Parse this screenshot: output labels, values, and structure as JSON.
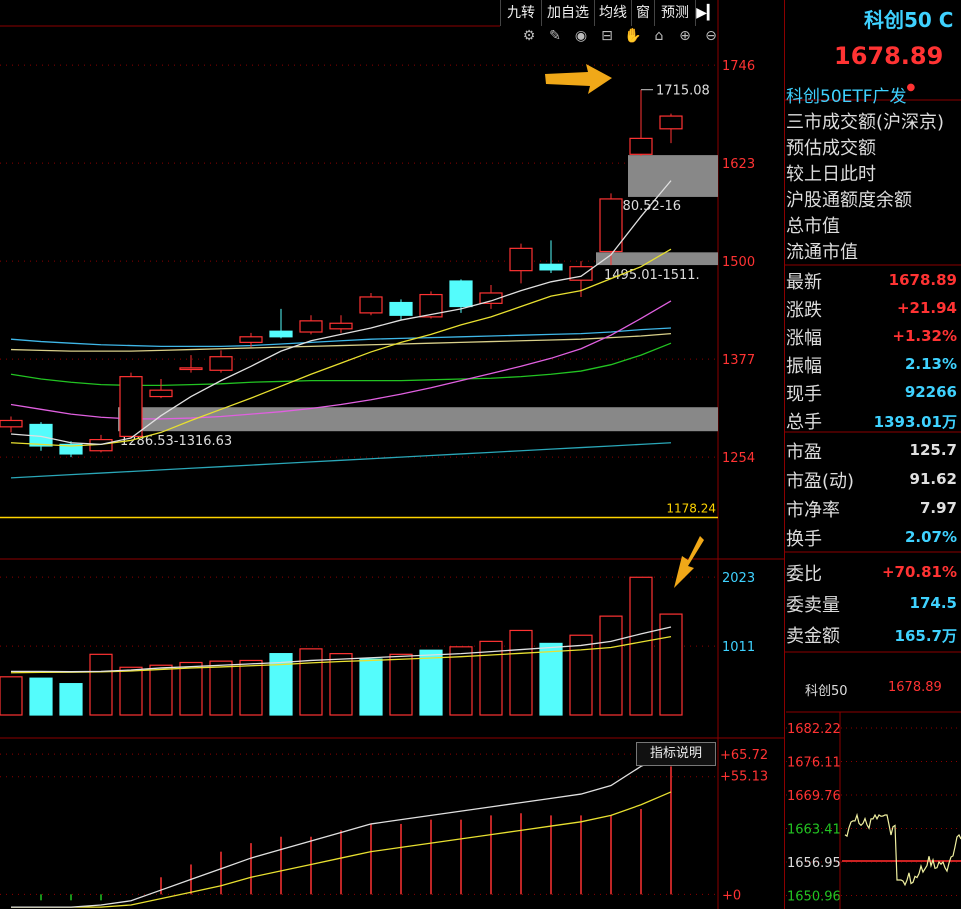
{
  "toolbar": {
    "buttons": [
      "九转",
      "加自选",
      "均线",
      "窗",
      "预测"
    ],
    "arrow_icon": "collapse-panel-icon",
    "icons": [
      "settings-icon",
      "brush-icon",
      "eye-icon",
      "basket-icon",
      "hand-icon",
      "lock-icon",
      "zoom-in-icon",
      "zoom-out-icon"
    ]
  },
  "right_panel": {
    "title": "科创50 C",
    "price": "1678.89",
    "subtitle": "科创50ETF广发",
    "info_rows": [
      "三市成交额(沪深京)",
      "预估成交额",
      "较上日此时",
      "沪股通额度余额",
      "总市值",
      "流通市值"
    ],
    "quote": [
      {
        "label": "最新",
        "value": "1678.89",
        "color": "red"
      },
      {
        "label": "涨跌",
        "value": "+21.94",
        "color": "red"
      },
      {
        "label": "涨幅",
        "value": "+1.32%",
        "color": "red"
      },
      {
        "label": "振幅",
        "value": "2.13%",
        "color": "cyan"
      },
      {
        "label": "现手",
        "value": "92266",
        "color": "cyan"
      },
      {
        "label": "总手",
        "value": "1393.01万",
        "color": "cyan"
      }
    ],
    "valuation": [
      {
        "label": "市盈",
        "value": "125.7",
        "color": "white"
      },
      {
        "label": "市盈(动)",
        "value": "91.62",
        "color": "white"
      },
      {
        "label": "市净率",
        "value": "7.97",
        "color": "white"
      },
      {
        "label": "换手",
        "value": "2.07%",
        "color": "cyan"
      }
    ],
    "orders": [
      {
        "label": "委比",
        "value": "+70.81%",
        "color": "red"
      },
      {
        "label": "委卖量",
        "value": "174.5",
        "color": "cyan"
      },
      {
        "label": "卖金额",
        "value": "165.7万",
        "color": "cyan"
      }
    ],
    "mini_chart": {
      "name": "科创50",
      "value": "1678.89",
      "price_labels": [
        "1682.22",
        "1676.11",
        "1669.76",
        "1663.41",
        "1656.95",
        "1650.96"
      ]
    }
  },
  "chart_data": [
    {
      "type": "candlestick",
      "yticks": [
        1746,
        1623,
        1500,
        1377,
        1254
      ],
      "ylim": [
        1150,
        1790
      ],
      "annotations": {
        "high_label": "1715.08",
        "support_low_label": "1286.53-1316.63",
        "support_low_range": [
          1286.53,
          1316.63
        ],
        "gap_top_label": "1580.52-16",
        "gap_top_range": [
          1580.52,
          1633
        ],
        "gap_mid_label": "1495.01-1511.",
        "gap_mid_range": [
          1495.01,
          1511
        ],
        "hline_label": "1178.24",
        "hline_value": 1178.24
      },
      "candles": [
        {
          "o": 1292,
          "c": 1300,
          "h": 1305,
          "l": 1285,
          "dir": "up"
        },
        {
          "o": 1295,
          "c": 1268,
          "h": 1298,
          "l": 1262,
          "dir": "down"
        },
        {
          "o": 1270,
          "c": 1258,
          "h": 1274,
          "l": 1254,
          "dir": "down"
        },
        {
          "o": 1262,
          "c": 1276,
          "h": 1282,
          "l": 1260,
          "dir": "up"
        },
        {
          "o": 1280,
          "c": 1355,
          "h": 1360,
          "l": 1278,
          "dir": "up"
        },
        {
          "o": 1330,
          "c": 1338,
          "h": 1352,
          "l": 1328,
          "dir": "up"
        },
        {
          "o": 1364,
          "c": 1366,
          "h": 1382,
          "l": 1360,
          "dir": "up"
        },
        {
          "o": 1363,
          "c": 1380,
          "h": 1388,
          "l": 1360,
          "dir": "up"
        },
        {
          "o": 1398,
          "c": 1405,
          "h": 1410,
          "l": 1392,
          "dir": "up"
        },
        {
          "o": 1412,
          "c": 1405,
          "h": 1440,
          "l": 1403,
          "dir": "down"
        },
        {
          "o": 1411,
          "c": 1425,
          "h": 1432,
          "l": 1408,
          "dir": "up"
        },
        {
          "o": 1415,
          "c": 1422,
          "h": 1432,
          "l": 1410,
          "dir": "up"
        },
        {
          "o": 1435,
          "c": 1455,
          "h": 1460,
          "l": 1432,
          "dir": "up"
        },
        {
          "o": 1448,
          "c": 1432,
          "h": 1452,
          "l": 1426,
          "dir": "down"
        },
        {
          "o": 1430,
          "c": 1458,
          "h": 1462,
          "l": 1428,
          "dir": "up"
        },
        {
          "o": 1475,
          "c": 1443,
          "h": 1477,
          "l": 1435,
          "dir": "down"
        },
        {
          "o": 1447,
          "c": 1460,
          "h": 1470,
          "l": 1440,
          "dir": "up"
        },
        {
          "o": 1488,
          "c": 1516,
          "h": 1522,
          "l": 1472,
          "dir": "up"
        },
        {
          "o": 1496,
          "c": 1489,
          "h": 1526,
          "l": 1485,
          "dir": "down"
        },
        {
          "o": 1476,
          "c": 1493,
          "h": 1500,
          "l": 1455,
          "dir": "up"
        },
        {
          "o": 1512,
          "c": 1578,
          "h": 1585,
          "l": 1495,
          "dir": "up"
        },
        {
          "o": 1634,
          "c": 1654,
          "h": 1715.08,
          "l": 1632,
          "dir": "up"
        },
        {
          "o": 1666,
          "c": 1682,
          "h": 1685,
          "l": 1648,
          "dir": "up"
        }
      ],
      "ma_white": [
        1283,
        1280,
        1272,
        1270,
        1278,
        1306,
        1330,
        1350,
        1368,
        1387,
        1400,
        1408,
        1416,
        1426,
        1433,
        1440,
        1450,
        1463,
        1474,
        1481,
        1508,
        1556,
        1601
      ],
      "ma_yellow": [
        1272,
        1270,
        1268,
        1270,
        1275,
        1285,
        1300,
        1314,
        1328,
        1343,
        1358,
        1372,
        1386,
        1398,
        1408,
        1420,
        1430,
        1443,
        1456,
        1463,
        1478,
        1493,
        1515
      ],
      "ma_magenta": [
        1320,
        1314,
        1308,
        1304,
        1302,
        1302,
        1303,
        1305,
        1308,
        1311,
        1315,
        1320,
        1326,
        1333,
        1341,
        1350,
        1359,
        1368,
        1378,
        1390,
        1407,
        1428,
        1450
      ],
      "ma_green": [
        1358,
        1352,
        1348,
        1345,
        1344,
        1344,
        1345,
        1346,
        1348,
        1349,
        1350,
        1350,
        1350,
        1350,
        1351,
        1352,
        1353,
        1355,
        1358,
        1362,
        1370,
        1382,
        1397
      ],
      "ma_blue": [
        1402,
        1399,
        1397,
        1395,
        1394,
        1393,
        1393,
        1393,
        1394,
        1396,
        1398,
        1400,
        1402,
        1403,
        1404,
        1405,
        1406,
        1407,
        1408,
        1409,
        1411,
        1414,
        1416
      ],
      "ma_khaki": [
        1389,
        1388,
        1387,
        1387,
        1387,
        1388,
        1389,
        1390,
        1391,
        1392,
        1393,
        1394,
        1395,
        1396,
        1397,
        1398,
        1399,
        1400,
        1401,
        1402,
        1404,
        1406,
        1409
      ],
      "ma_teal": [
        1228,
        1230,
        1232,
        1234,
        1236,
        1238,
        1240,
        1242,
        1244,
        1246,
        1248,
        1250,
        1252,
        1254,
        1256,
        1258,
        1260,
        1262,
        1264,
        1266,
        1268,
        1270,
        1272
      ]
    },
    {
      "type": "bar",
      "name": "volume",
      "yticks": [
        2023,
        1011
      ],
      "ylim": [
        0,
        2200
      ],
      "values": [
        560,
        540,
        460,
        890,
        700,
        730,
        770,
        790,
        800,
        900,
        970,
        900,
        820,
        890,
        950,
        1000,
        1080,
        1240,
        1050,
        1170,
        1450,
        2020,
        1480
      ],
      "dirs": [
        "up",
        "down",
        "down",
        "up",
        "up",
        "up",
        "up",
        "up",
        "up",
        "down",
        "up",
        "up",
        "down",
        "up",
        "down",
        "up",
        "up",
        "up",
        "down",
        "up",
        "up",
        "up",
        "up"
      ],
      "ma_white": [
        640,
        640,
        635,
        640,
        660,
        690,
        710,
        730,
        750,
        770,
        800,
        820,
        840,
        860,
        880,
        900,
        930,
        960,
        990,
        1020,
        1080,
        1190,
        1290
      ],
      "ma_yellow": [
        620,
        625,
        628,
        632,
        645,
        668,
        690,
        705,
        722,
        740,
        765,
        785,
        800,
        818,
        836,
        855,
        880,
        905,
        930,
        955,
        990,
        1070,
        1150
      ]
    },
    {
      "type": "bar",
      "name": "indicator",
      "button": "指标说明",
      "labels": [
        "+65.72",
        "+55.13",
        "+0"
      ],
      "ylim": [
        -5,
        70
      ],
      "bars": [
        0,
        0,
        0,
        0,
        0,
        8,
        14,
        20,
        24,
        27,
        27,
        30,
        33,
        33,
        35,
        35,
        37,
        38,
        37,
        37,
        37,
        40,
        60
      ],
      "bar_dirs": [
        "zero",
        "green",
        "green",
        "green",
        "zero",
        "red",
        "red",
        "red",
        "red",
        "red",
        "red",
        "red",
        "red",
        "red",
        "red",
        "red",
        "red",
        "red",
        "red",
        "red",
        "red",
        "red",
        "red"
      ],
      "white_line": [
        -6,
        -6,
        -6,
        -5,
        -3,
        2,
        7,
        12,
        17,
        21,
        25,
        29,
        33,
        35,
        37,
        39,
        41,
        43,
        45,
        47,
        51,
        60,
        65.72
      ],
      "yellow_line": [
        -6,
        -6,
        -6,
        -6,
        -5,
        -2,
        1,
        4,
        8,
        11,
        14,
        17,
        20,
        22,
        24,
        26,
        28,
        30,
        32,
        34,
        37,
        42,
        48
      ]
    }
  ]
}
